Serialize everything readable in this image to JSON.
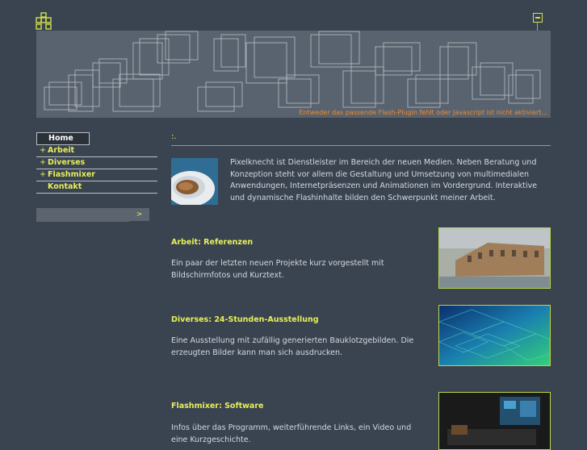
{
  "header": {
    "logo_icon": "grid-cross-logo",
    "minimize_icon": "minimize-icon",
    "banner_message": "Entweder das passende Flash-Plugin fehlt oder Javascript ist nicht aktiviert..."
  },
  "nav": {
    "items": [
      {
        "label": "Home",
        "active": true,
        "plus": ""
      },
      {
        "label": "Arbeit",
        "active": false,
        "plus": "+"
      },
      {
        "label": "Diverses",
        "active": false,
        "plus": "+"
      },
      {
        "label": "Flashmixer",
        "active": false,
        "plus": "+"
      },
      {
        "label": "Kontakt",
        "active": false,
        "plus": ""
      }
    ],
    "search_go_label": ">"
  },
  "main": {
    "crumb": ":.",
    "intro": "Pixelknecht ist Dienstleister im Bereich der neuen Medien. Neben Beratung und Konzeption steht vor allem die Gestaltung und Umsetzung von multimedialen Anwendungen, Internetpräsenzen und Animationen im Vordergrund. Interaktive und dynamische Flashinhalte bilden den Schwerpunkt meiner Arbeit.",
    "sections": [
      {
        "title": "Arbeit: Referenzen",
        "text": "Ein paar der letzten neuen Projekte kurz vorgestellt mit Bildschirmfotos und Kurztext."
      },
      {
        "title": "Diverses: 24-Stunden-Ausstellung",
        "text": "Eine Ausstellung mit zufällig generierten Bauklotzgebilden. Die erzeugten Bilder kann man sich ausdrucken."
      },
      {
        "title": "Flashmixer: Software",
        "text": "Infos über das Programm, weiterführende Links, ein Video und eine Kurzgeschichte."
      }
    ]
  },
  "colors": {
    "accent": "#e6f05a",
    "background": "#3a4350",
    "banner_text": "#f08a2a"
  }
}
